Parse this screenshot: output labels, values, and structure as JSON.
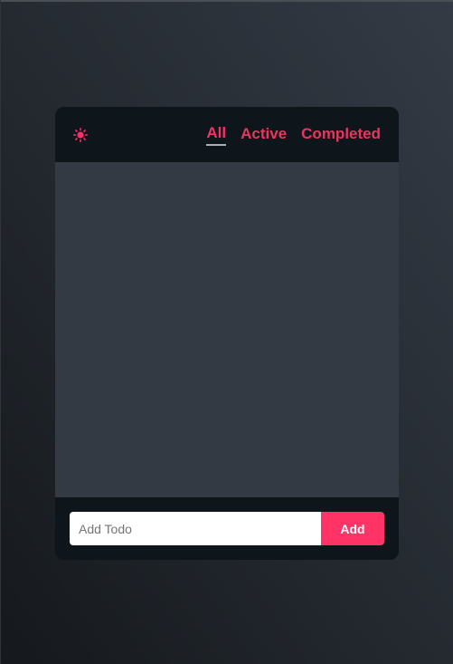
{
  "header": {
    "theme_icon": "sun-icon",
    "filters": [
      {
        "label": "All",
        "selected": true
      },
      {
        "label": "Active",
        "selected": false
      },
      {
        "label": "Completed",
        "selected": false
      }
    ]
  },
  "todo_list": {
    "items": []
  },
  "footer": {
    "input_value": "",
    "input_placeholder": "Add Todo",
    "add_label": "Add"
  },
  "colors": {
    "accent": "#ff3366",
    "card_bar": "#0e161c",
    "list_bg": "#333a44"
  }
}
